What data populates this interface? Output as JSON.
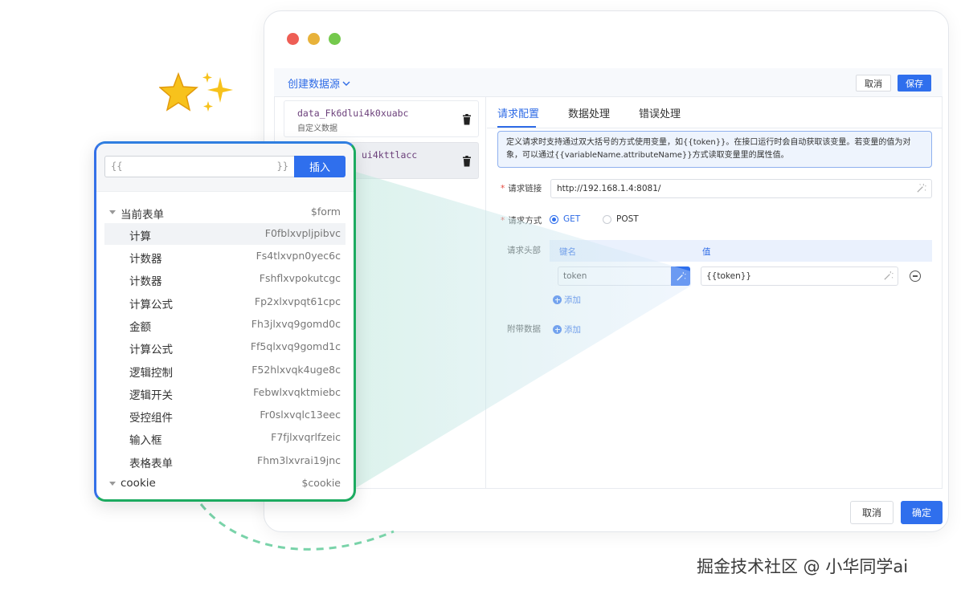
{
  "window": {
    "topbar": {
      "title": "创建数据源",
      "cancel_label": "取消",
      "save_label": "保存"
    },
    "datasources": [
      {
        "name": "data_Fk6dlui4k0xuabc",
        "subtitle": "自定义数据"
      },
      {
        "name": "ui4kttlacc",
        "subtitle": ""
      }
    ],
    "tabs": [
      {
        "label": "请求配置",
        "active": true
      },
      {
        "label": "数据处理",
        "active": false
      },
      {
        "label": "错误处理",
        "active": false
      }
    ],
    "info_text": "定义请求时支持通过双大括号的方式使用变量，如{{token}}。在接口运行时会自动获取该变量。若变量的值为对象，可以通过{{variableName.attributeName}}方式读取变量里的属性值。",
    "form": {
      "url_label": "请求链接",
      "url_value": "http://192.168.1.4:8081/",
      "method_label": "请求方式",
      "methods": [
        {
          "label": "GET",
          "selected": true
        },
        {
          "label": "POST",
          "selected": false
        }
      ],
      "headers_label": "请求头部",
      "headers_col_key": "键名",
      "headers_col_value": "值",
      "header_key": "token",
      "header_value": "{{token}}",
      "add_label": "添加",
      "extra_label": "附带数据",
      "extra_add_label": "添加"
    },
    "footer": {
      "cancel_label": "取消",
      "confirm_label": "确定"
    }
  },
  "panel": {
    "input_open": "{{",
    "input_close": "}}",
    "insert_label": "插入",
    "groups": [
      {
        "label": "当前表单",
        "value": "$form",
        "children": [
          {
            "label": "计算",
            "value": "F0fblxvpljpibvc"
          },
          {
            "label": "计数器",
            "value": "Fs4tlxvpn0yec6c"
          },
          {
            "label": "计数器",
            "value": "Fshflxvpokutcgc"
          },
          {
            "label": "计算公式",
            "value": "Fp2xlxvpqt61cpc"
          },
          {
            "label": "金额",
            "value": "Fh3jlxvq9gomd0c"
          },
          {
            "label": "计算公式",
            "value": "Ff5qlxvq9gomd1c"
          },
          {
            "label": "逻辑控制",
            "value": "F52hlxvqk4uge8c"
          },
          {
            "label": "逻辑开关",
            "value": "Febwlxvqktmiebc"
          },
          {
            "label": "受控组件",
            "value": "Fr0slxvqlc13eec"
          },
          {
            "label": "输入框",
            "value": "F7fjlxvqrlfzeic"
          },
          {
            "label": "表格表单",
            "value": "Fhm3lxvrai19jnc"
          }
        ]
      },
      {
        "label": "cookie",
        "value": "$cookie"
      }
    ]
  },
  "watermark": "掘金技术社区 @ 小华同学ai",
  "colors": {
    "accent": "#2f6fed",
    "panel_border_green": "#1cab60",
    "panel_border_blue": "#3470e8"
  }
}
